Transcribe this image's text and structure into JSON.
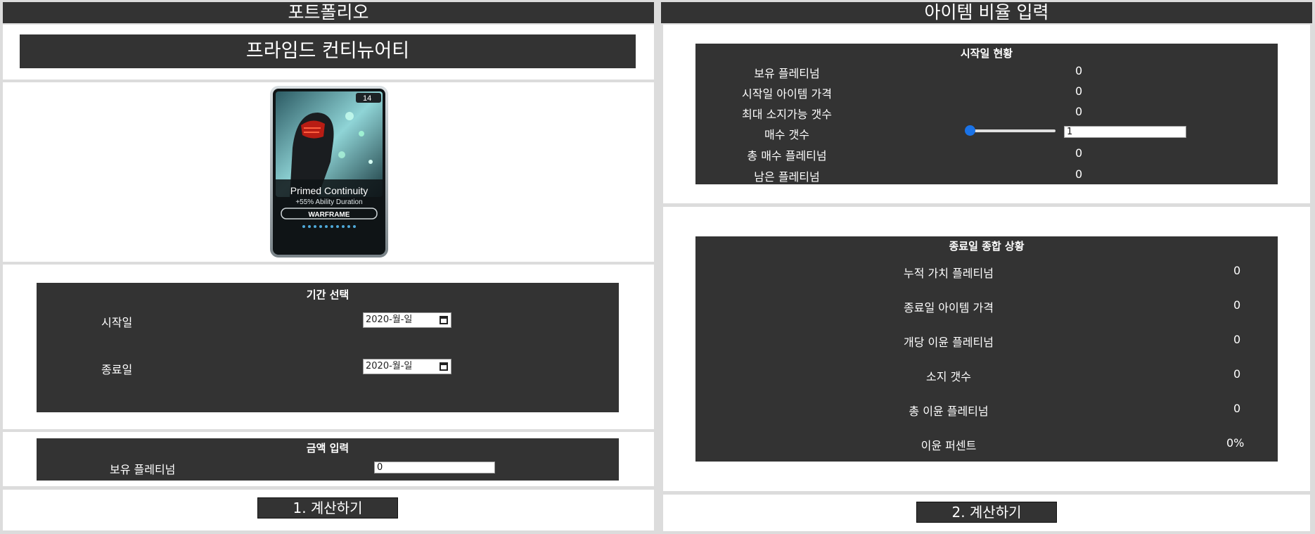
{
  "left": {
    "header": "포트폴리오",
    "item_name": "프라임드 컨티뉴어티",
    "card": {
      "title": "Primed Continuity",
      "stat": "+55% Ability Duration",
      "category": "WARFRAME",
      "rank": "14"
    },
    "period": {
      "title": "기간 선택",
      "start_label": "시작일",
      "start_value": "2020-월-일",
      "end_label": "종료일",
      "end_value": "2020-월-일"
    },
    "amount": {
      "title": "금액 입력",
      "label": "보유 플레티넘",
      "value": "0"
    },
    "button": "1. 계산하기"
  },
  "right": {
    "header": "아이템 비율 입력",
    "start_status": {
      "title": "시작일 현황",
      "rows": [
        {
          "label": "보유 플레티넘",
          "value": "0"
        },
        {
          "label": "시작일 아이템 가격",
          "value": "0"
        },
        {
          "label": "최대 소지가능 갯수",
          "value": "0"
        },
        {
          "label": "매수 갯수",
          "value": "1"
        },
        {
          "label": "총 매수 플레티넘",
          "value": "0"
        },
        {
          "label": "남은 플레티넘",
          "value": "0"
        }
      ],
      "slider_level": 0
    },
    "end_status": {
      "title": "종료일 종합 상황",
      "rows": [
        {
          "label": "누적 가치 플레티넘",
          "value": "0"
        },
        {
          "label": "종료일 아이템 가격",
          "value": "0"
        },
        {
          "label": "개당 이윤 플레티넘",
          "value": "0"
        },
        {
          "label": "소지 갯수",
          "value": "0"
        },
        {
          "label": "총 이윤 플레티넘",
          "value": "0"
        },
        {
          "label": "이윤 퍼센트",
          "value": "0%"
        }
      ]
    },
    "button": "2. 계산하기"
  },
  "colors": {
    "dark": "#333333",
    "panel": "#ffffff",
    "background": "#dcdcdc",
    "slider_accent": "#1a73e8"
  }
}
